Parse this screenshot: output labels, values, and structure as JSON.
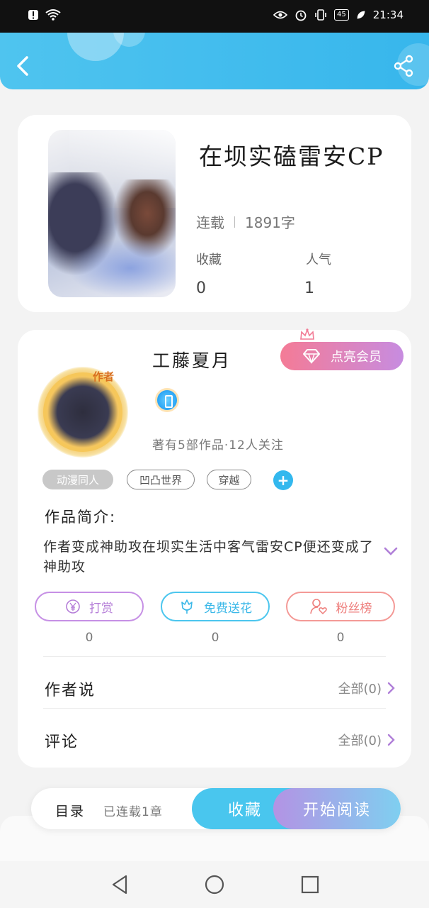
{
  "status_bar": {
    "time": "21:34",
    "battery": "45"
  },
  "header": {
    "back_icon": "chevron-left-icon",
    "share_icon": "share-icon"
  },
  "book": {
    "title": "在坝实磕雷安CP",
    "status": "连载",
    "word_count": "1891字",
    "favorites_label": "收藏",
    "favorites_value": "0",
    "popularity_label": "人气",
    "popularity_value": "1"
  },
  "author": {
    "badge": "作者",
    "name": "工藤夏月",
    "vip_button": "点亮会员",
    "stats": "著有5部作品·12人关注"
  },
  "tags": [
    "动漫同人",
    "凹凸世界",
    "穿越"
  ],
  "intro": {
    "title": "作品简介:",
    "text": "作者变成神助攻在坝实生活中客气雷安CP便还变成了神助攻"
  },
  "actions": {
    "tip_label": "打赏",
    "tip_count": "0",
    "flower_label": "免费送花",
    "flower_count": "0",
    "fans_label": "粉丝榜",
    "fans_count": "0"
  },
  "rows": {
    "author_says": "作者说",
    "author_says_link": "全部(0)",
    "comments": "评论",
    "comments_link": "全部(0)"
  },
  "bottom_bar": {
    "toc": "目录",
    "serial_status": "已连载1章",
    "collect": "收藏",
    "start_reading": "开始阅读"
  },
  "colors": {
    "header_blue": "#37b6ec",
    "accent_purple": "#b57ed8",
    "accent_pink": "#ee7e7c"
  }
}
